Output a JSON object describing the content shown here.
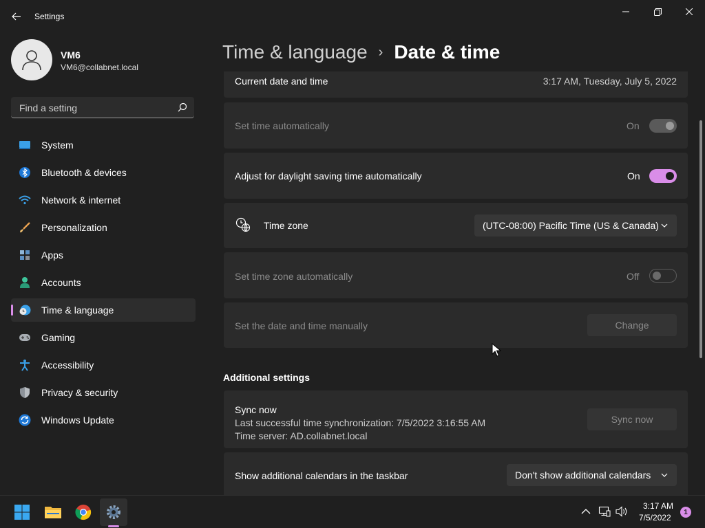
{
  "window": {
    "title": "Settings",
    "back_icon": "arrow-left-icon",
    "controls": [
      "minimize-icon",
      "maximize-icon",
      "close-icon"
    ]
  },
  "profile": {
    "name": "VM6",
    "email": "VM6@collabnet.local",
    "avatar_icon": "person-icon"
  },
  "search": {
    "placeholder": "Find a setting",
    "icon": "search-icon"
  },
  "nav": {
    "items": [
      {
        "label": "System",
        "icon": "monitor-icon"
      },
      {
        "label": "Bluetooth & devices",
        "icon": "bluetooth-icon"
      },
      {
        "label": "Network & internet",
        "icon": "wifi-icon"
      },
      {
        "label": "Personalization",
        "icon": "brush-icon"
      },
      {
        "label": "Apps",
        "icon": "apps-icon"
      },
      {
        "label": "Accounts",
        "icon": "accounts-icon"
      },
      {
        "label": "Time & language",
        "icon": "clock-globe-icon",
        "selected": true
      },
      {
        "label": "Gaming",
        "icon": "gamepad-icon"
      },
      {
        "label": "Accessibility",
        "icon": "accessibility-icon"
      },
      {
        "label": "Privacy & security",
        "icon": "shield-icon"
      },
      {
        "label": "Windows Update",
        "icon": "update-icon"
      }
    ]
  },
  "breadcrumb": {
    "parent": "Time & language",
    "separator": "›",
    "current": "Date & time"
  },
  "settings": {
    "current": {
      "label": "Current date and time",
      "value": "3:17 AM, Tuesday, July 5, 2022"
    },
    "set_time_auto": {
      "label": "Set time automatically",
      "state": "On",
      "enabled": false
    },
    "dst": {
      "label": "Adjust for daylight saving time automatically",
      "state": "On",
      "enabled": true
    },
    "time_zone": {
      "label": "Time zone",
      "value": "(UTC-08:00) Pacific Time (US & Canada)",
      "icon": "timezone-globe-icon"
    },
    "set_tz_auto": {
      "label": "Set time zone automatically",
      "state": "Off",
      "enabled": false
    },
    "manual": {
      "label": "Set the date and time manually",
      "button": "Change"
    }
  },
  "additional": {
    "title": "Additional settings",
    "sync": {
      "title": "Sync now",
      "last_sync": "Last successful time synchronization: 7/5/2022 3:16:55 AM",
      "server": "Time server: AD.collabnet.local",
      "button": "Sync now"
    },
    "calendars": {
      "label": "Show additional calendars in the taskbar",
      "value": "Don't show additional calendars"
    }
  },
  "taskbar": {
    "apps": [
      {
        "name": "start",
        "icon": "windows-logo-icon"
      },
      {
        "name": "file-explorer",
        "icon": "folder-icon"
      },
      {
        "name": "chrome",
        "icon": "chrome-icon"
      },
      {
        "name": "settings",
        "icon": "gear-icon",
        "active": true
      }
    ],
    "tray": [
      "chevron-up-icon",
      "network-icon",
      "volume-icon"
    ],
    "time": "3:17 AM",
    "date": "7/5/2022",
    "notifications": "1"
  },
  "colors": {
    "accent": "#d98de8",
    "background": "#202020",
    "card": "#2b2b2b"
  }
}
